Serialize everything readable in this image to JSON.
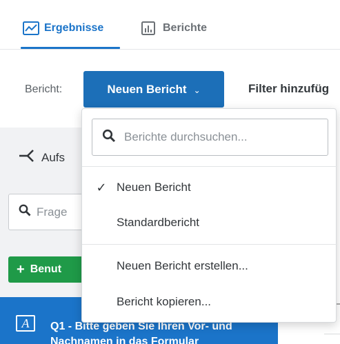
{
  "tabs": [
    {
      "label": "Ergebnisse",
      "icon": "chart-line-icon",
      "active": true
    },
    {
      "label": "Berichte",
      "icon": "bar-chart-icon",
      "active": false
    }
  ],
  "toolbar": {
    "report_label": "Bericht:",
    "report_button": "Neuen Bericht",
    "filter_label": "Filter hinzufüg"
  },
  "left_panel": {
    "breakdown_label": "Aufs",
    "search_placeholder": "Frage",
    "new_button": "Benut",
    "question_text": "Q1 - Bitte geben Sie Ihren Vor- und Nachnamen in das Formular"
  },
  "dropdown": {
    "search_placeholder": "Berichte durchsuchen...",
    "reports": [
      {
        "label": "Neuen Bericht",
        "selected": true
      },
      {
        "label": "Standardbericht",
        "selected": false
      }
    ],
    "actions": [
      {
        "label": "Neuen Bericht erstellen..."
      },
      {
        "label": "Bericht kopieren..."
      }
    ]
  },
  "colors": {
    "accent": "#1b74c9",
    "button_blue": "#1c6fb8",
    "green": "#1f9a48"
  }
}
